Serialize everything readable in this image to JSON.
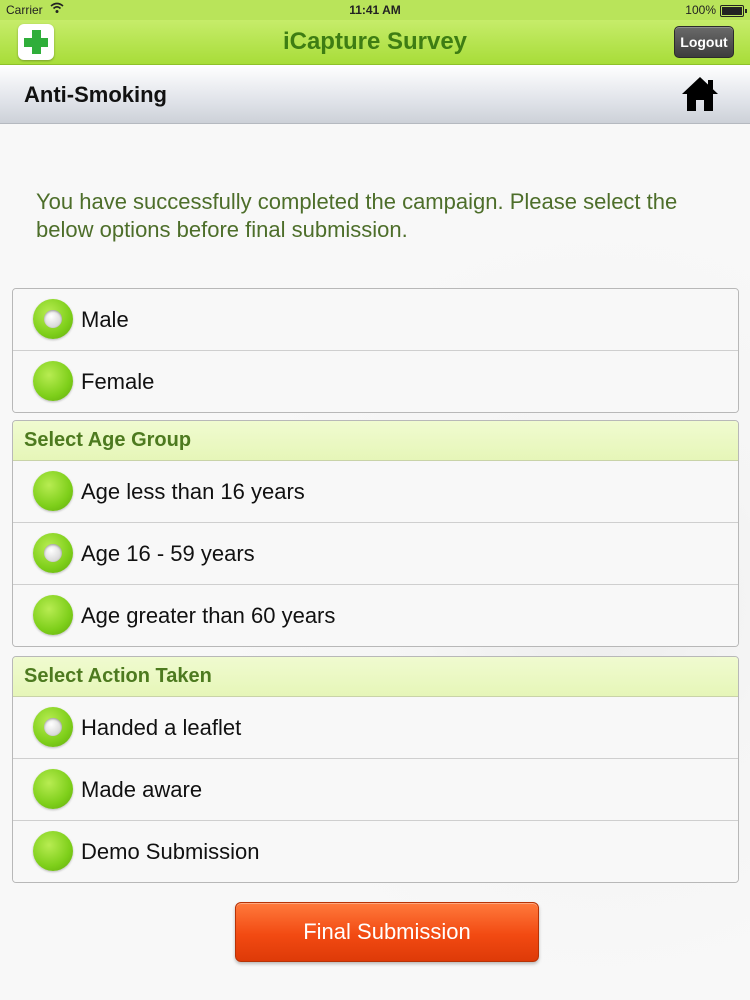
{
  "status_bar": {
    "carrier": "Carrier",
    "time": "11:41 AM",
    "battery": "100%"
  },
  "navbar": {
    "title": "iCapture Survey",
    "logout_label": "Logout",
    "logo_icon": "green-cross-icon"
  },
  "subheader": {
    "title": "Anti-Smoking",
    "home_icon": "home-icon"
  },
  "message": "You have successfully completed the campaign. Please select the below options before final submission.",
  "gender": {
    "options": [
      {
        "label": "Male",
        "selected": true
      },
      {
        "label": "Female",
        "selected": false
      }
    ]
  },
  "age_group": {
    "header": "Select Age Group",
    "options": [
      {
        "label": "Age less than 16 years",
        "selected": false
      },
      {
        "label": "Age 16 - 59 years",
        "selected": true
      },
      {
        "label": "Age greater than 60 years",
        "selected": false
      }
    ]
  },
  "action_taken": {
    "header": "Select Action Taken",
    "options": [
      {
        "label": "Handed a leaflet",
        "selected": true
      },
      {
        "label": "Made aware",
        "selected": false
      },
      {
        "label": "Demo Submission",
        "selected": false
      }
    ]
  },
  "submit_label": "Final Submission",
  "colors": {
    "header_green": "#a8dd39",
    "radio_green": "#7ecf1a",
    "submit_orange": "#f24a12",
    "message_text": "#4d6e2a"
  }
}
